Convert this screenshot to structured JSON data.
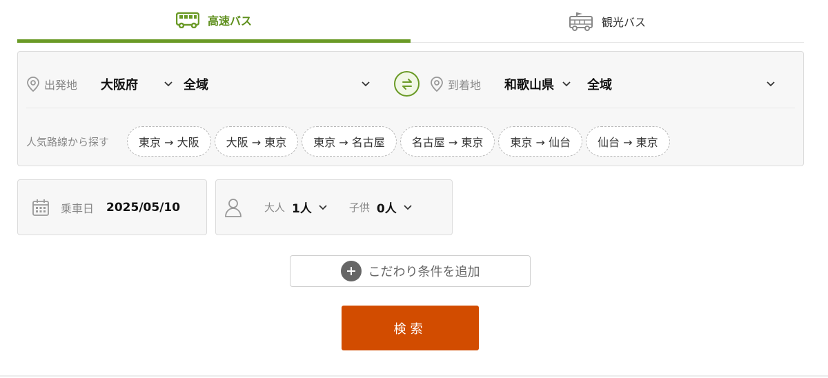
{
  "tabs": [
    {
      "label": "高速バス",
      "icon": "highway-bus-icon",
      "active": true
    },
    {
      "label": "観光バス",
      "icon": "tour-bus-icon",
      "active": false
    }
  ],
  "route": {
    "departure": {
      "label": "出発地",
      "prefecture": "大阪府",
      "area": "全域"
    },
    "arrival": {
      "label": "到着地",
      "prefecture": "和歌山県",
      "area": "全域"
    }
  },
  "popular": {
    "label": "人気路線から探す",
    "routes": [
      "東京 → 大阪",
      "大阪 → 東京",
      "東京 → 名古屋",
      "名古屋 → 東京",
      "東京 → 仙台",
      "仙台 → 東京"
    ]
  },
  "date": {
    "label": "乗車日",
    "value": "2025/05/10"
  },
  "passengers": {
    "adult": {
      "label": "大人",
      "value": "1人"
    },
    "child": {
      "label": "子供",
      "value": "0人"
    }
  },
  "more_conditions": "こだわり条件を追加",
  "search_label": "検索",
  "colors": {
    "accent": "#6a9a26",
    "search": "#d24c00"
  }
}
